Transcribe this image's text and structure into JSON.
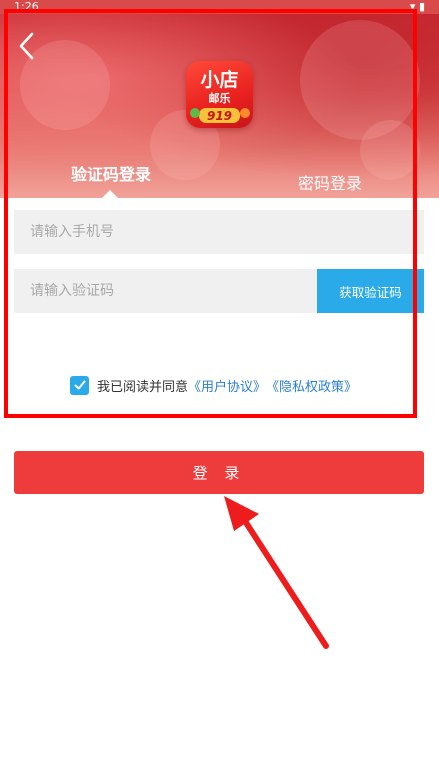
{
  "status_bar": {
    "time": "1:26",
    "right": "▾ ▮"
  },
  "header": {
    "back_icon": "chevron-left-icon",
    "logo": {
      "line1": "小店",
      "line2": "邮乐",
      "badge": "919",
      "colors": {
        "primary": "#e8201e",
        "badge": "#f7c23a"
      }
    }
  },
  "tabs": [
    {
      "label": "验证码登录",
      "active": true
    },
    {
      "label": "密码登录",
      "active": false
    }
  ],
  "form": {
    "phone": {
      "placeholder": "请输入手机号",
      "value": ""
    },
    "code": {
      "placeholder": "请输入验证码",
      "value": ""
    },
    "get_code_label": "获取验证码"
  },
  "agreement": {
    "checked": true,
    "prefix": "我已阅读并同意",
    "user_agreement": "《用户协议》",
    "privacy_policy": "《隐私权政策》"
  },
  "login_label": "登 录",
  "colors": {
    "brand_red": "#ee3b3b",
    "accent_blue": "#2aaae8",
    "link_blue": "#2a7fd4",
    "annotation_red": "#ff0000"
  }
}
